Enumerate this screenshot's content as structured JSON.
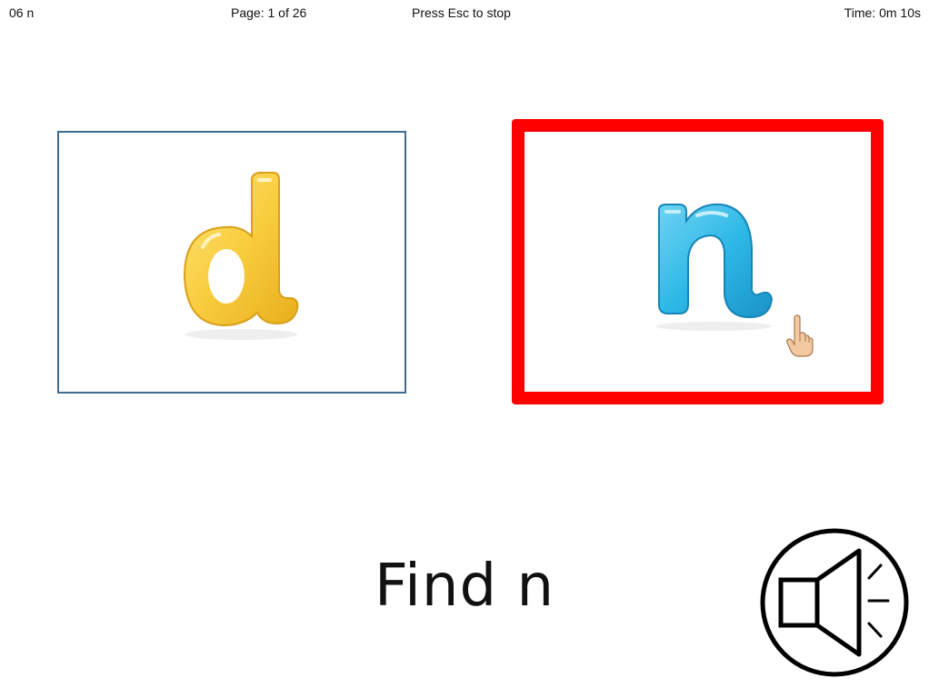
{
  "header": {
    "activity_name": "06 n",
    "page_indicator": "Page: 1 of 26",
    "exit_hint": "Press Esc to stop",
    "timer": "Time: 0m 10s"
  },
  "choices": [
    {
      "letter": "d",
      "color": "#f6c93b",
      "highlighted": false
    },
    {
      "letter": "n",
      "color": "#29b6e6",
      "highlighted": true
    }
  ],
  "prompt": {
    "text": "Find n"
  },
  "colors": {
    "highlight_border": "#ff0000",
    "default_border": "#3f6b8f"
  },
  "icons": {
    "audio": "speaker-icon",
    "pointer": "hand-pointer-icon"
  }
}
